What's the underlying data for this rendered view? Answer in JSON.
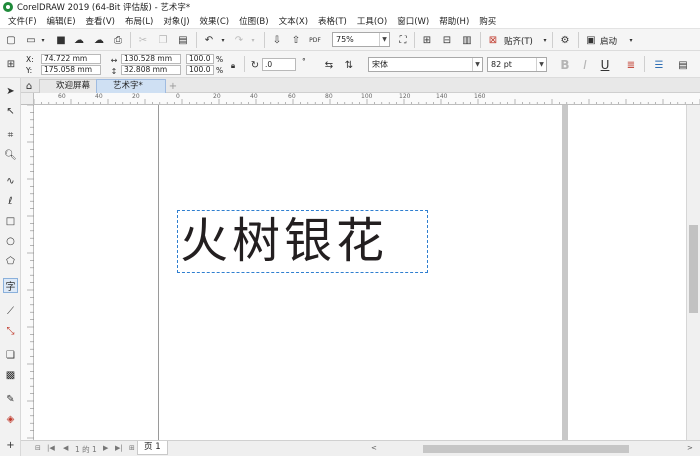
{
  "window": {
    "title": "CorelDRAW 2019 (64-Bit 评估版) - 艺术字*"
  },
  "menu": [
    "文件(F)",
    "编辑(E)",
    "查看(V)",
    "布局(L)",
    "对象(J)",
    "效果(C)",
    "位图(B)",
    "文本(X)",
    "表格(T)",
    "工具(O)",
    "窗口(W)",
    "帮助(H)",
    "购买"
  ],
  "standard_toolbar": {
    "zoom": "75%",
    "snap_label": "贴齐(T)",
    "launch_label": "启动",
    "pdf_label": "PDF"
  },
  "property_bar": {
    "x_label": "X:",
    "y_label": "Y:",
    "x": "74.722 mm",
    "y": "175.058 mm",
    "width": "130.528 mm",
    "height": "32.808 mm",
    "scale_x": "100.0",
    "scale_y": "100.0",
    "percent": "%",
    "rotation": ".0",
    "degree": "°",
    "font_name": "宋体",
    "font_size": "82 pt",
    "bold": "B",
    "italic": "I",
    "underline": "U"
  },
  "tabs": [
    {
      "label": "欢迎屏幕"
    },
    {
      "label": "艺术字*"
    }
  ],
  "add_tab": "+",
  "ruler_labels": [
    "60",
    "40",
    "20",
    "0",
    "20",
    "40",
    "60",
    "80",
    "100",
    "120",
    "140",
    "160"
  ],
  "canvas": {
    "text": "火树银花"
  },
  "page_nav": {
    "counter": "1 的 1",
    "page_label": "页 1"
  },
  "colors": {
    "frame": "#2f7fd0",
    "text": "#231f20",
    "logo": "#1f8a3a"
  }
}
